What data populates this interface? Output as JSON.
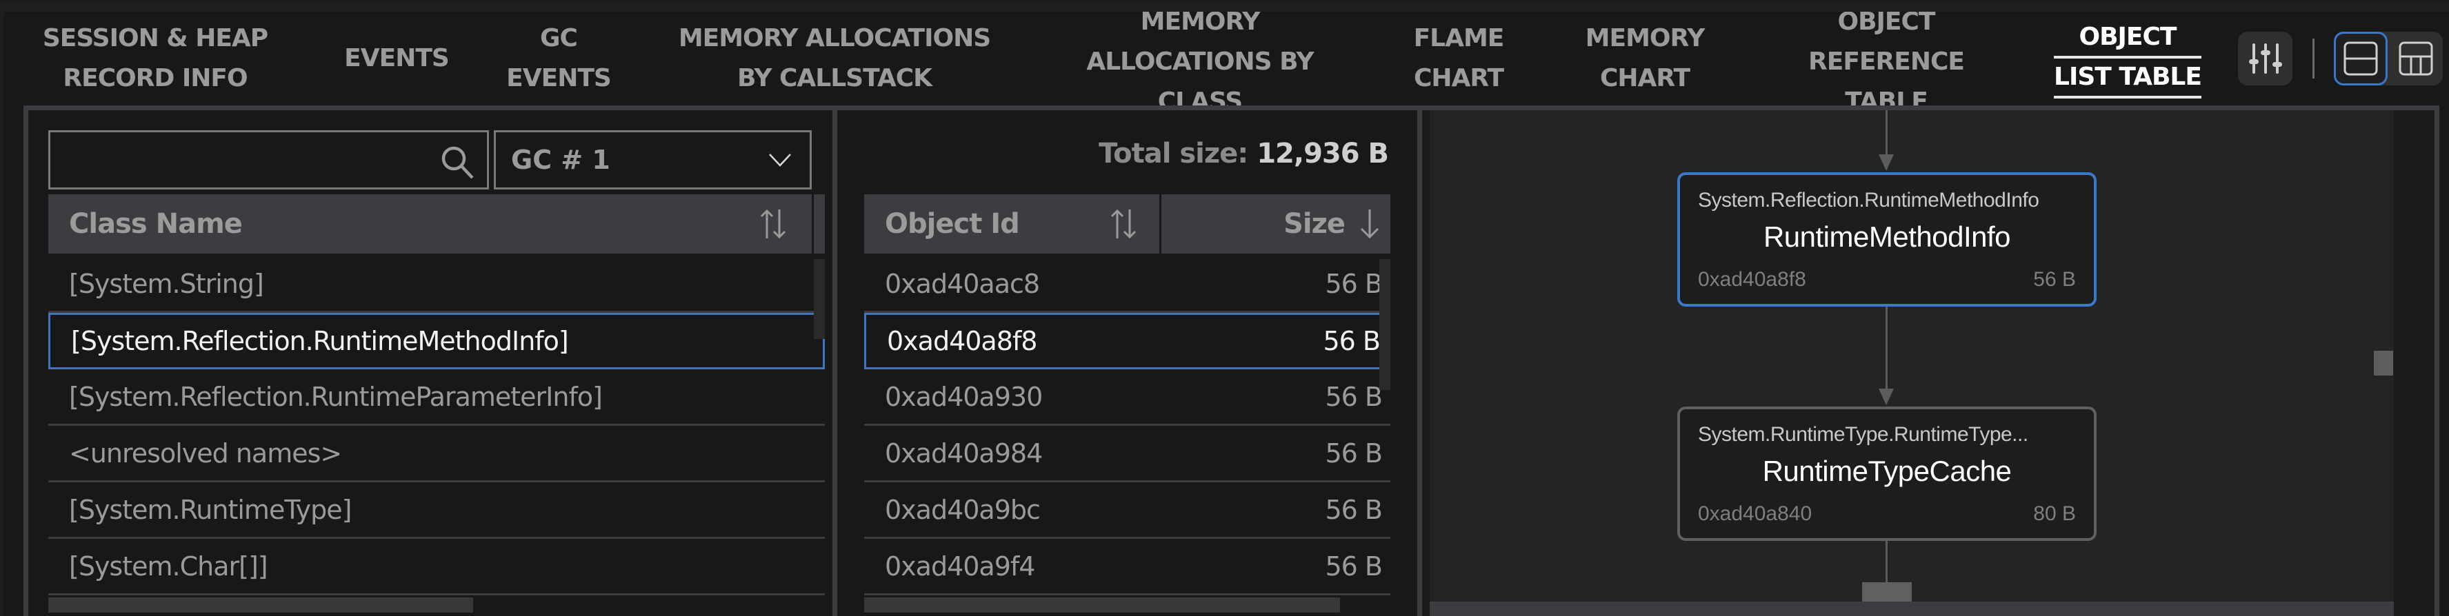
{
  "nav": {
    "tabs": [
      {
        "line1": "SESSION & HEAP",
        "line2": "RECORD INFO",
        "line3": "",
        "active": false
      },
      {
        "line1": "EVENTS",
        "line2": "",
        "line3": "",
        "active": false
      },
      {
        "line1": "GC",
        "line2": "EVENTS",
        "line3": "",
        "active": false
      },
      {
        "line1": "MEMORY ALLOCATIONS",
        "line2": "BY CALLSTACK",
        "line3": "",
        "active": false
      },
      {
        "line1": "MEMORY",
        "line2": "ALLOCATIONS BY",
        "line3": "CLASS",
        "active": false
      },
      {
        "line1": "FLAME",
        "line2": "CHART",
        "line3": "",
        "active": false
      },
      {
        "line1": "MEMORY",
        "line2": "CHART",
        "line3": "",
        "active": false
      },
      {
        "line1": "OBJECT",
        "line2": "REFERENCE",
        "line3": "TABLE",
        "active": false
      },
      {
        "line1": "OBJECT",
        "line2": "LIST TABLE",
        "line3": "",
        "active": true
      }
    ],
    "settings_icon": "sliders-icon",
    "layout_options": [
      {
        "icon": "layout-two-rows-icon",
        "selected": true
      },
      {
        "icon": "layout-grid-icon",
        "selected": false
      }
    ]
  },
  "class_panel": {
    "search": {
      "value": "",
      "placeholder": ""
    },
    "gc_select": {
      "value": "GC # 1"
    },
    "header": {
      "class_name": "Class Name"
    },
    "rows": [
      {
        "name": "[System.String]",
        "selected": false
      },
      {
        "name": "[System.Reflection.RuntimeMethodInfo]",
        "selected": true
      },
      {
        "name": "[System.Reflection.RuntimeParameterInfo]",
        "selected": false
      },
      {
        "name": "<unresolved names>",
        "selected": false
      },
      {
        "name": "[System.RuntimeType]",
        "selected": false
      },
      {
        "name": "[System.Char[]]",
        "selected": false
      }
    ]
  },
  "object_panel": {
    "total_label": "Total size:",
    "total_value": "12,936 B",
    "header": {
      "object_id": "Object Id",
      "size": "Size"
    },
    "rows": [
      {
        "id": "0xad40aac8",
        "size": "56 B",
        "selected": false
      },
      {
        "id": "0xad40a8f8",
        "size": "56 B",
        "selected": true
      },
      {
        "id": "0xad40a930",
        "size": "56 B",
        "selected": false
      },
      {
        "id": "0xad40a984",
        "size": "56 B",
        "selected": false
      },
      {
        "id": "0xad40a9bc",
        "size": "56 B",
        "selected": false
      },
      {
        "id": "0xad40a9f4",
        "size": "56 B",
        "selected": false
      }
    ]
  },
  "graph": {
    "nodes": [
      {
        "full_name": "System.Reflection.RuntimeMethodInfo",
        "short_name": "RuntimeMethodInfo",
        "object_id": "0xad40a8f8",
        "size": "56 B",
        "selected": true
      },
      {
        "full_name": "System.RuntimeType.RuntimeType...",
        "short_name": "RuntimeTypeCache",
        "object_id": "0xad40a840",
        "size": "80 B",
        "selected": false
      }
    ],
    "hint": ""
  },
  "colors": {
    "accent": "#3a78c9",
    "background": "#181818",
    "panel_border": "#3c3d41",
    "graph_bg": "#242424"
  }
}
